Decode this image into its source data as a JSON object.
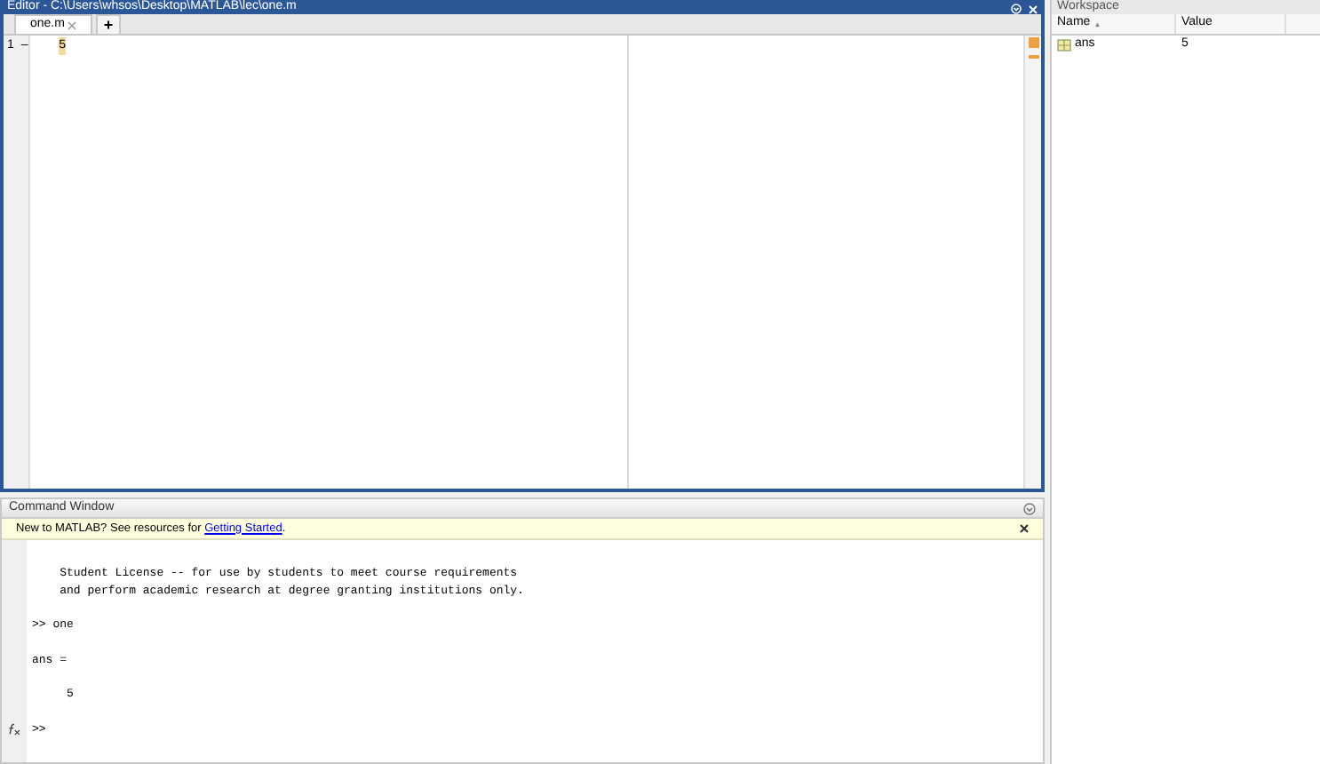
{
  "editor": {
    "title": "Editor - C:\\Users\\whsos\\Desktop\\MATLAB\\lec\\one.m",
    "tabs": [
      {
        "label": "one.m",
        "selected": true
      }
    ],
    "add_tab": "+",
    "lines": [
      {
        "number": "1",
        "marker": "–",
        "code": "5",
        "highlighted": true
      }
    ]
  },
  "command_window": {
    "title": "Command Window",
    "banner": {
      "text": "New to MATLAB? See resources for ",
      "link": "Getting Started",
      "suffix": "."
    },
    "blocks": [
      [
        "    Student License -- for use by students to meet course requirements",
        "    and perform academic research at degree granting institutions only."
      ],
      [
        ">> one"
      ],
      [
        "ans ="
      ],
      [
        "     5"
      ]
    ],
    "prompt": ">>"
  },
  "workspace": {
    "title": "Workspace",
    "columns": [
      {
        "label": "Name",
        "arrow": "▲"
      },
      {
        "label": "Value"
      }
    ],
    "rows": [
      {
        "name": "ans",
        "value": "5"
      }
    ]
  }
}
